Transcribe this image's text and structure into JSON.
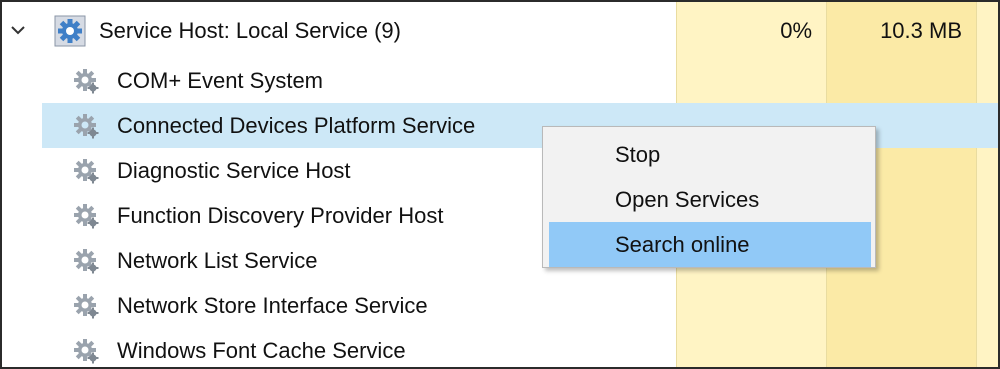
{
  "group": {
    "label": "Service Host: Local Service (9)",
    "cpu": "0%",
    "memory": "10.3 MB",
    "expand_icon": "chevron-down-icon",
    "icon": "service-host-icon"
  },
  "services": [
    {
      "label": "COM+ Event System",
      "icon": "gear-icon"
    },
    {
      "label": "Connected Devices Platform Service",
      "icon": "gear-icon",
      "selected": true
    },
    {
      "label": "Diagnostic Service Host",
      "icon": "gear-icon"
    },
    {
      "label": "Function Discovery Provider Host",
      "icon": "gear-icon"
    },
    {
      "label": "Network List Service",
      "icon": "gear-icon"
    },
    {
      "label": "Network Store Interface Service",
      "icon": "gear-icon"
    },
    {
      "label": "Windows Font Cache Service",
      "icon": "gear-icon"
    }
  ],
  "context_menu": {
    "items": [
      "Stop",
      "Open Services",
      "Search online"
    ],
    "highlighted": "Search online"
  },
  "colors": {
    "selection": "#cde8f7",
    "menu_highlight": "#91c9f7",
    "cpu_column": "#fff4c4",
    "memory_column": "#fbeaa6"
  }
}
